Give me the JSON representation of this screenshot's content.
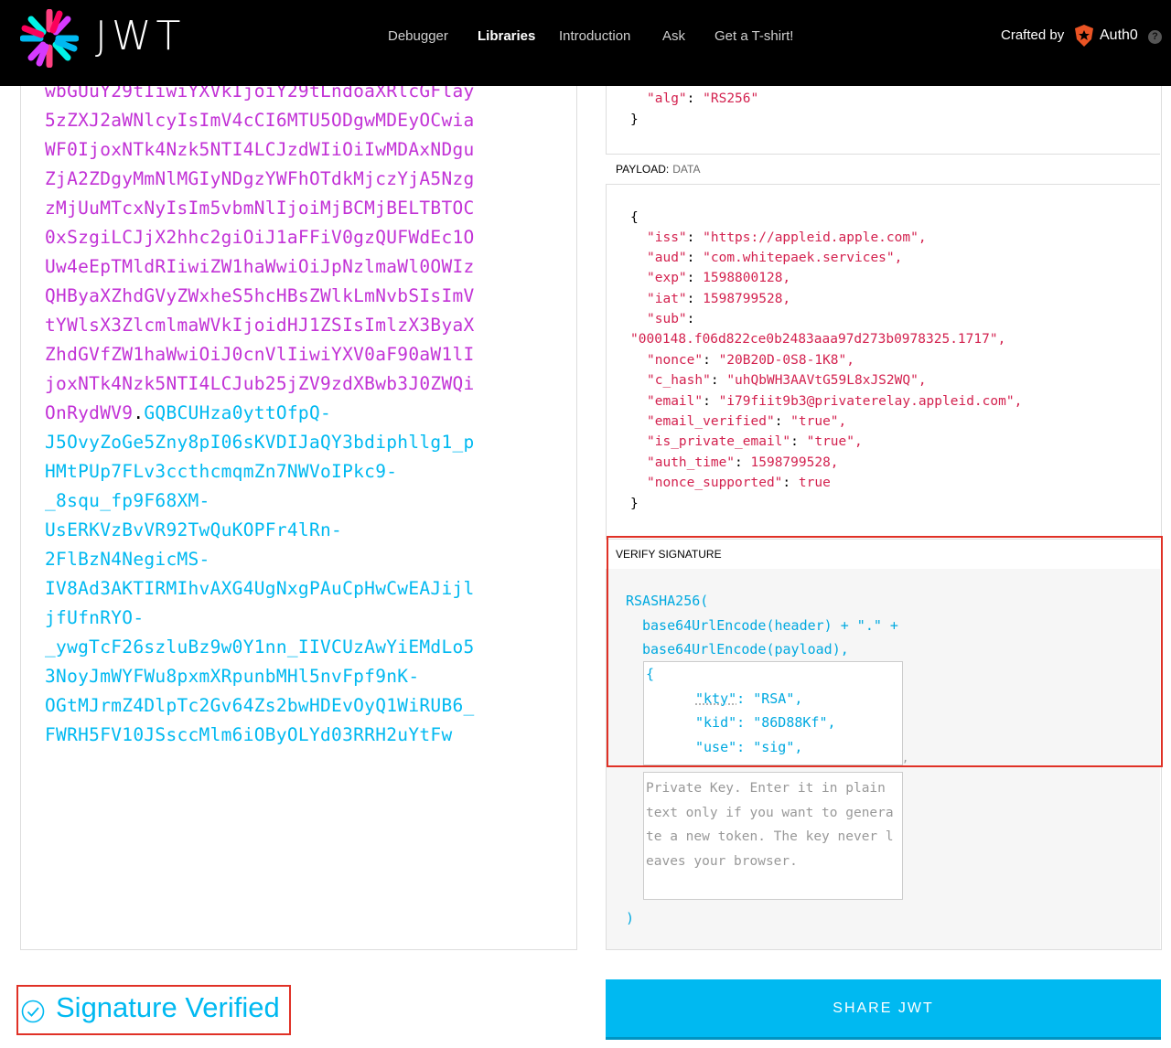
{
  "header": {
    "logo_text": "JWT",
    "nav": [
      "Debugger",
      "Libraries",
      "Introduction",
      "Ask",
      "Get a T-shirt!"
    ],
    "crafted_by": "Crafted by",
    "brand": "Auth0",
    "help": "?"
  },
  "encoded": {
    "payload_lines": [
      "wbGUuY29tIiwiYXVkIjoiY29tLndoaXRlcGFlay",
      "5zZXJ2aWNlcyIsImV4cCI6MTU5ODgwMDEyOCwia",
      "WF0IjoxNTk4Nzk5NTI4LCJzdWIiOiIwMDAxNDgu",
      "ZjA2ZDgyMmNlMGIyNDgzYWFhOTdkMjczYjA5Nzg",
      "zMjUuMTcxNyIsIm5vbmNlIjoiMjBCMjBELTBTOC",
      "0xSzgiLCJjX2hhc2giOiJ1aFFiV0gzQUFWdEc1O",
      "Uw4eEpTMldRIiwiZW1haWwiOiJpNzlmaWl0OWIz",
      "QHByaXZhdGVyZWxheS5hcHBsZWlkLmNvbSIsImV",
      "tYWlsX3ZlcmlmaWVkIjoidHJ1ZSIsImlzX3ByaX",
      "ZhdGVfZW1haWwiOiJ0cnVlIiwiYXV0aF90aW1lI",
      "joxNTk4Nzk5NTI4LCJub25jZV9zdXBwb3J0ZWQi"
    ],
    "mixed_payload": "OnRydWV9",
    "mixed_dot": ".",
    "mixed_sig": "GQBCUHza0yttOfpQ-",
    "sig_lines": [
      "J5OvyZoGe5Zny8pI06sKVDIJaQY3bdiphllg1_p",
      "HMtPUp7FLv3ccthcmqmZn7NWVoIPkc9-",
      "_8squ_fp9F68XM-",
      "UsERKVzBvVR92TwQuKOPFr4lRn-",
      "2FlBzN4NegicMS-",
      "IV8Ad3AKTIRMIhvAXG4UgNxgPAuCpHwCwEAJijl",
      "jfUfnRYO-",
      "_ywgTcF26szluBz9w0Y1nn_IIVCUzAwYiEMdLo5",
      "3NoyJmWYFWu8pxmXRpunbMHl5nvFpf9nK-",
      "OGtMJrmZ4DlpTc2Gv64Zs2bwHDEvOyQ1WiRUB6_",
      "FWRH5FV10JSsccMlm6iOByOLYd03RRH2uYtFw"
    ]
  },
  "header_json": {
    "alg_key": "\"alg\"",
    "alg_value": "\"RS256\"",
    "close": "}"
  },
  "payload_section": {
    "label": "PAYLOAD:",
    "sublabel": "DATA",
    "open": "{",
    "close": "}",
    "iss_k": "\"iss\"",
    "iss_v": "\"https://appleid.apple.com\",",
    "aud_k": "\"aud\"",
    "aud_v": "\"com.whitepaek.services\",",
    "exp_k": "\"exp\"",
    "exp_v": "1598800128,",
    "iat_k": "\"iat\"",
    "iat_v": "1598799528,",
    "sub_k": "\"sub\"",
    "sub_v": "\"000148.f06d822ce0b2483aaa97d273b0978325.1717\",",
    "nonce_k": "\"nonce\"",
    "nonce_v": "\"20B20D-0S8-1K8\",",
    "c_hash_k": "\"c_hash\"",
    "c_hash_v": "\"uhQbWH3AAVtG59L8xJS2WQ\",",
    "email_k": "\"email\"",
    "email_v": "\"i79fiit9b3@privaterelay.appleid.com\",",
    "email_verified_k": "\"email_verified\"",
    "email_verified_v": "\"true\",",
    "is_private_email_k": "\"is_private_email\"",
    "is_private_email_v": "\"true\",",
    "auth_time_k": "\"auth_time\"",
    "auth_time_v": "1598799528,",
    "nonce_supported_k": "\"nonce_supported\"",
    "nonce_supported_v": "true"
  },
  "verify": {
    "label": "VERIFY SIGNATURE",
    "fn": "RSASHA256(",
    "line1": "base64UrlEncode(header) + \".\" +",
    "line2": "base64UrlEncode(payload),",
    "key_open": "{",
    "kty_k": "\"kty\"",
    "kty_v": "\"RSA\",",
    "kid_k": "\"kid\"",
    "kid_v": "\"86D88Kf\",",
    "use_k": "\"use\"",
    "use_v": "\"sig\",",
    "comma": ",",
    "private_key_placeholder": "Private Key. Enter it in plain text only if you want to generate a new token. The key never leaves your browser.",
    "close": ")"
  },
  "status": {
    "verified_text": "Signature Verified",
    "share_button": "SHARE JWT"
  },
  "colors": {
    "payload": "#c232d6",
    "signature": "#00b9f1",
    "json_key": "#d3224f",
    "highlight": "#e03126"
  }
}
